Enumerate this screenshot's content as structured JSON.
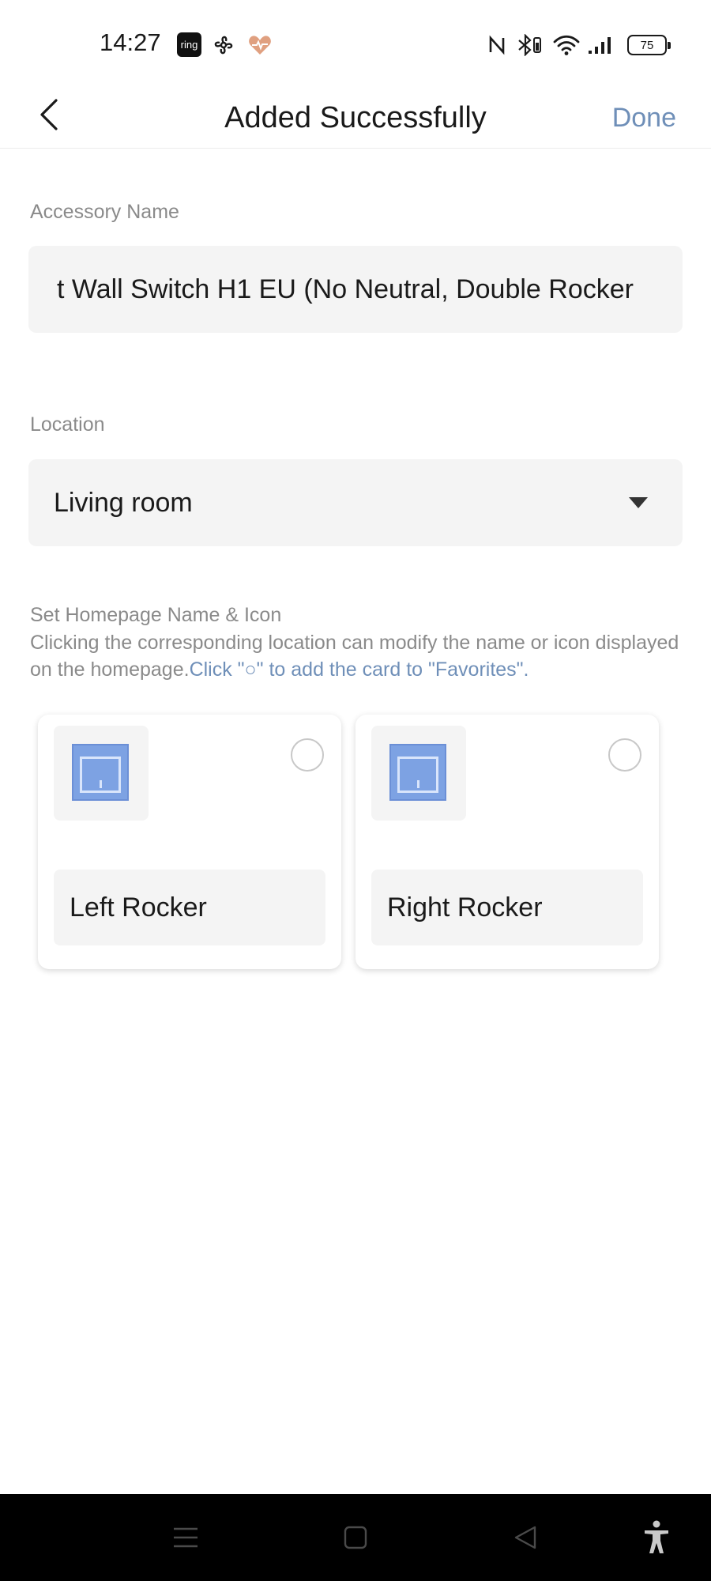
{
  "status_bar": {
    "time": "14:27",
    "ring_label": "ring",
    "battery": "75",
    "icons": [
      "ring-icon",
      "fan-icon",
      "heart-rate-icon",
      "nfc-icon",
      "bluetooth-icon",
      "wifi-icon",
      "signal-icon",
      "battery-icon"
    ]
  },
  "header": {
    "title": "Added Successfully",
    "done_label": "Done",
    "back_icon": "chevron-left-icon"
  },
  "accessory_name": {
    "label": "Accessory Name",
    "value": "t Wall Switch H1 EU (No Neutral, Double Rocker"
  },
  "location": {
    "label": "Location",
    "value": "Living room",
    "arrow_icon": "caret-down-icon"
  },
  "homepage": {
    "title": "Set Homepage Name & Icon",
    "description": "Clicking the corresponding location can modify the name or icon displayed on the homepage.",
    "hint": "Click \"○\" to add the card to \"Favorites\"."
  },
  "cards": [
    {
      "name": "Left Rocker",
      "icon": "wall-switch-icon",
      "favorite": false
    },
    {
      "name": "Right Rocker",
      "icon": "wall-switch-icon",
      "favorite": false
    }
  ],
  "nav_bar": {
    "icons": [
      "menu-icon",
      "home-square-icon",
      "back-triangle-icon",
      "accessibility-icon"
    ]
  },
  "colors": {
    "accent": "#6f8fb8",
    "switch_icon": "#7da2e3",
    "field_bg": "#f4f4f4",
    "label_gray": "#8a8a8a"
  }
}
